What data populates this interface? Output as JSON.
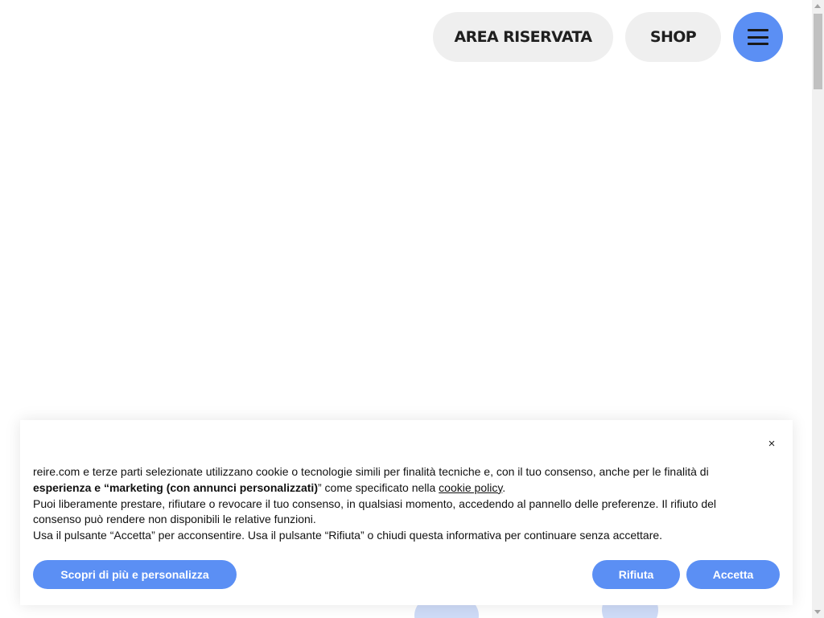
{
  "header": {
    "reserved_area_label": "AREA RISERVATA",
    "shop_label": "SHOP",
    "menu_icon": "hamburger-menu-icon"
  },
  "cookie_banner": {
    "close_glyph": "×",
    "close_icon": "close-icon",
    "line1_text": "reire.com e terze parti selezionate utilizzano cookie o tecnologie simili per finalità tecniche e, con il tuo consenso, anche per le finalità di",
    "line2_bold": "esperienza e “marketing (con annunci personalizzati)",
    "line2_after": "” come specificato nella ",
    "cookie_policy_link": "cookie policy",
    "line2_end": ".",
    "paragraph2": "Puoi liberamente prestare, rifiutare o revocare il tuo consenso, in qualsiasi momento, accedendo al pannello delle preferenze. Il rifiuto del consenso può rendere non disponibili le relative funzioni.",
    "paragraph3": "Usa il pulsante “Accetta” per acconsentire. Usa il pulsante “Rifiuta” o chiudi questa informativa per continuare senza accettare.",
    "learn_more_label": "Scopri di più e personalizza",
    "reject_label": "Rifiuta",
    "accept_label": "Accetta"
  },
  "colors": {
    "accent_blue": "#5b8ff4",
    "pill_gray": "#efefef",
    "text_dark": "#1f1f1f",
    "hero_blue": "#3a66c4",
    "hero_light_blue": "#9db8ef"
  }
}
